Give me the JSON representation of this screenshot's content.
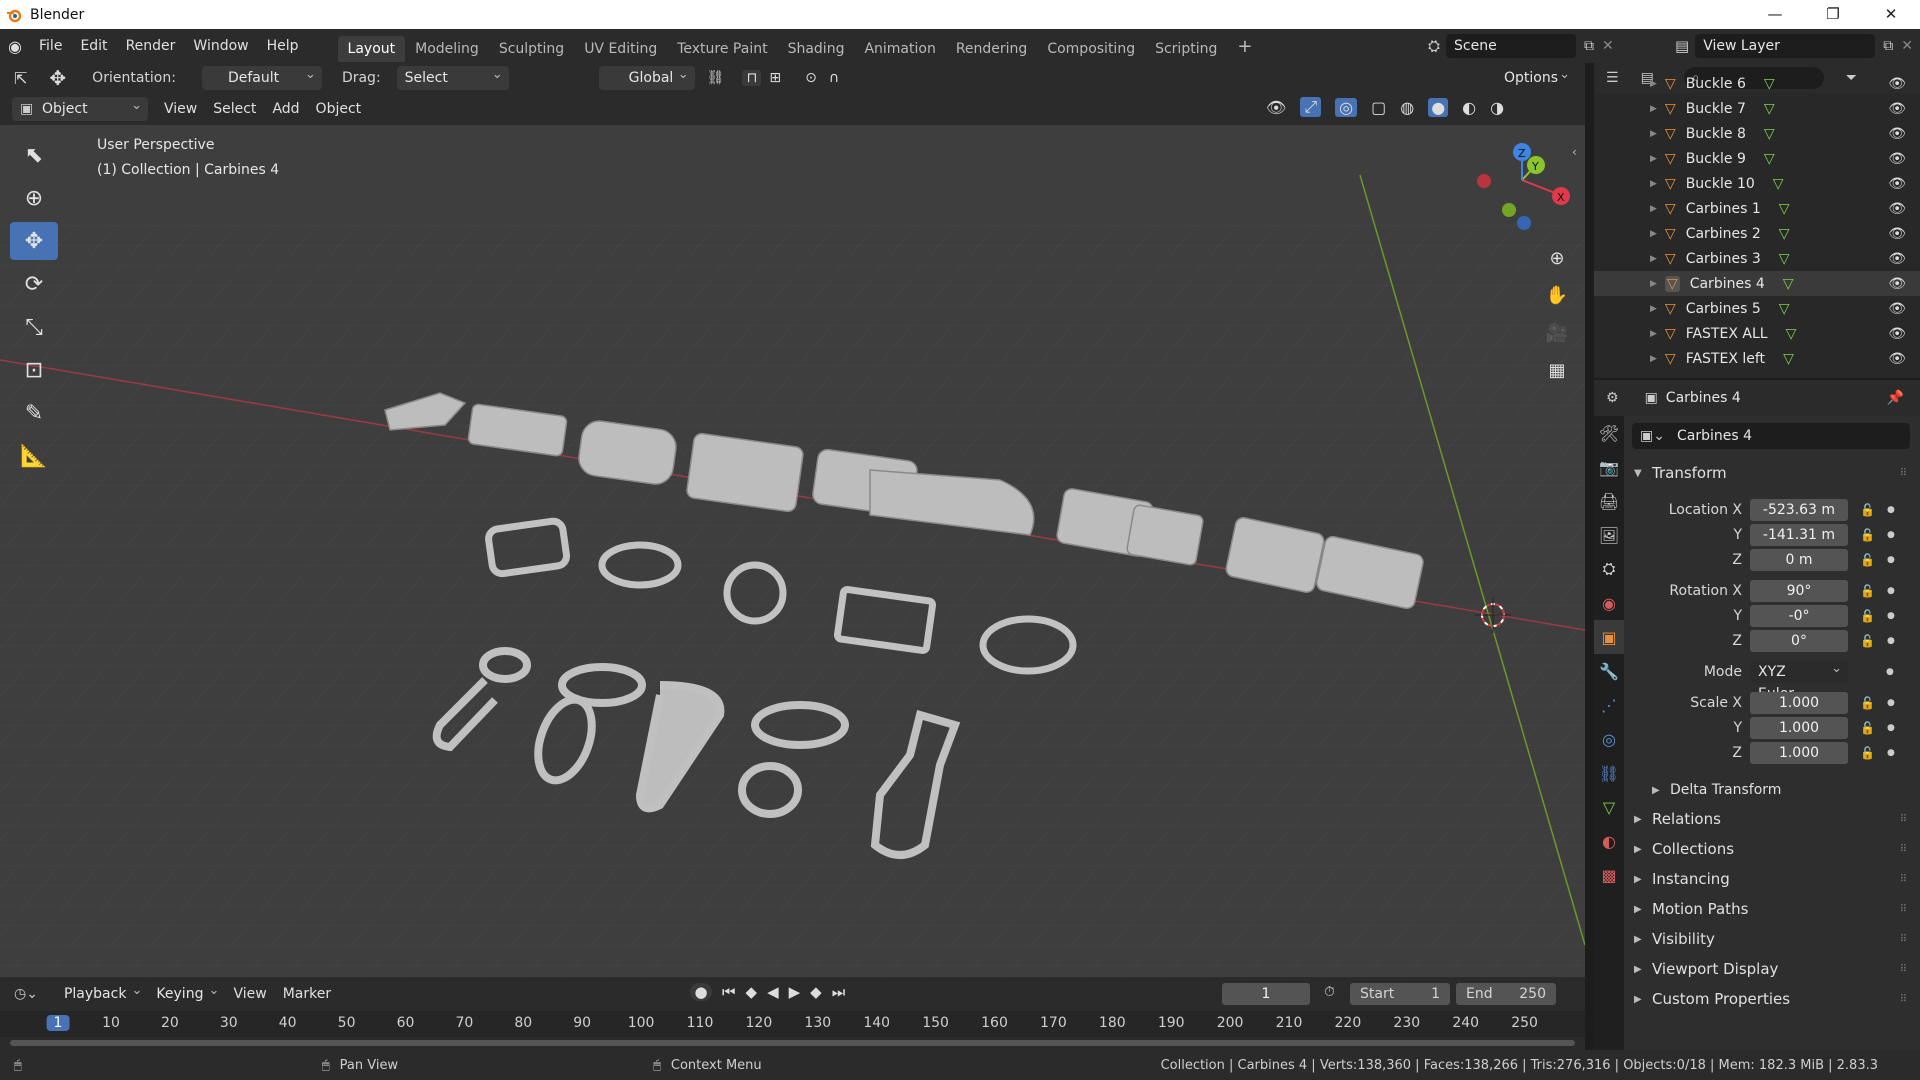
{
  "window": {
    "title": "Blender",
    "controls": [
      "—",
      "❐",
      "✕"
    ]
  },
  "menu": [
    "File",
    "Edit",
    "Render",
    "Window",
    "Help"
  ],
  "workspaces": [
    "Layout",
    "Modeling",
    "Sculpting",
    "UV Editing",
    "Texture Paint",
    "Shading",
    "Animation",
    "Rendering",
    "Compositing",
    "Scripting"
  ],
  "active_workspace": "Layout",
  "scene": {
    "name": "Scene",
    "view_layer": "View Layer"
  },
  "tool_header": {
    "orientation_label": "Orientation:",
    "orientation_value": "Default",
    "drag_label": "Drag:",
    "drag_value": "Select Circle",
    "transform_orientation": "Global",
    "options_label": "Options"
  },
  "view_header": {
    "mode": "Object Mode",
    "menus": [
      "View",
      "Select",
      "Add",
      "Object"
    ]
  },
  "viewport": {
    "perspective": "User Perspective",
    "collection_info": "(1) Collection | Carbines 4",
    "gizmo_axes": [
      "X",
      "Y",
      "Z"
    ]
  },
  "outliner": {
    "items": [
      {
        "name": "Buckle 6",
        "selected": false
      },
      {
        "name": "Buckle 7",
        "selected": false
      },
      {
        "name": "Buckle 8",
        "selected": false
      },
      {
        "name": "Buckle 9",
        "selected": false
      },
      {
        "name": "Buckle 10",
        "selected": false
      },
      {
        "name": "Carbines 1",
        "selected": false
      },
      {
        "name": "Carbines 2",
        "selected": false
      },
      {
        "name": "Carbines 3",
        "selected": false
      },
      {
        "name": "Carbines 4",
        "selected": true
      },
      {
        "name": "Carbines 5",
        "selected": false
      },
      {
        "name": "FASTEX ALL",
        "selected": false
      },
      {
        "name": "FASTEX left",
        "selected": false
      }
    ]
  },
  "properties": {
    "header_object": "Carbines 4",
    "object_name": "Carbines 4",
    "transform_title": "Transform",
    "location": {
      "label_x": "Location X",
      "x": "-523.63 m",
      "y": "-141.31 m",
      "z": "0 m"
    },
    "rotation": {
      "label_x": "Rotation X",
      "x": "90°",
      "y": "-0°",
      "z": "0°"
    },
    "mode_label": "Mode",
    "mode_value": "XYZ Euler",
    "scale": {
      "label_x": "Scale X",
      "x": "1.000",
      "y": "1.000",
      "z": "1.000"
    },
    "axis_y": "Y",
    "axis_z": "Z",
    "delta_transform": "Delta Transform",
    "panels": [
      "Relations",
      "Collections",
      "Instancing",
      "Motion Paths",
      "Visibility",
      "Viewport Display",
      "Custom Properties"
    ]
  },
  "timeline": {
    "menus": [
      "Playback",
      "Keying",
      "View",
      "Marker"
    ],
    "current_frame": "1",
    "start_label": "Start",
    "start": "1",
    "end_label": "End",
    "end": "250",
    "ticks": [
      "1",
      "10",
      "20",
      "30",
      "40",
      "50",
      "60",
      "70",
      "80",
      "90",
      "100",
      "110",
      "120",
      "130",
      "140",
      "150",
      "160",
      "170",
      "180",
      "190",
      "200",
      "210",
      "220",
      "230",
      "240",
      "250"
    ]
  },
  "statusbar": {
    "pan": "Pan View",
    "context": "Context Menu",
    "stats": "Collection | Carbines 4 | Verts:138,360 | Faces:138,266 | Tris:276,316 | Objects:0/18 | Mem: 182.3 MiB | 2.83.3"
  },
  "colors": {
    "accent": "#4772b3",
    "x_axis": "#e0394a",
    "y_axis": "#8ac52e",
    "z_axis": "#3f84e0",
    "object_orange": "#e8913a"
  }
}
